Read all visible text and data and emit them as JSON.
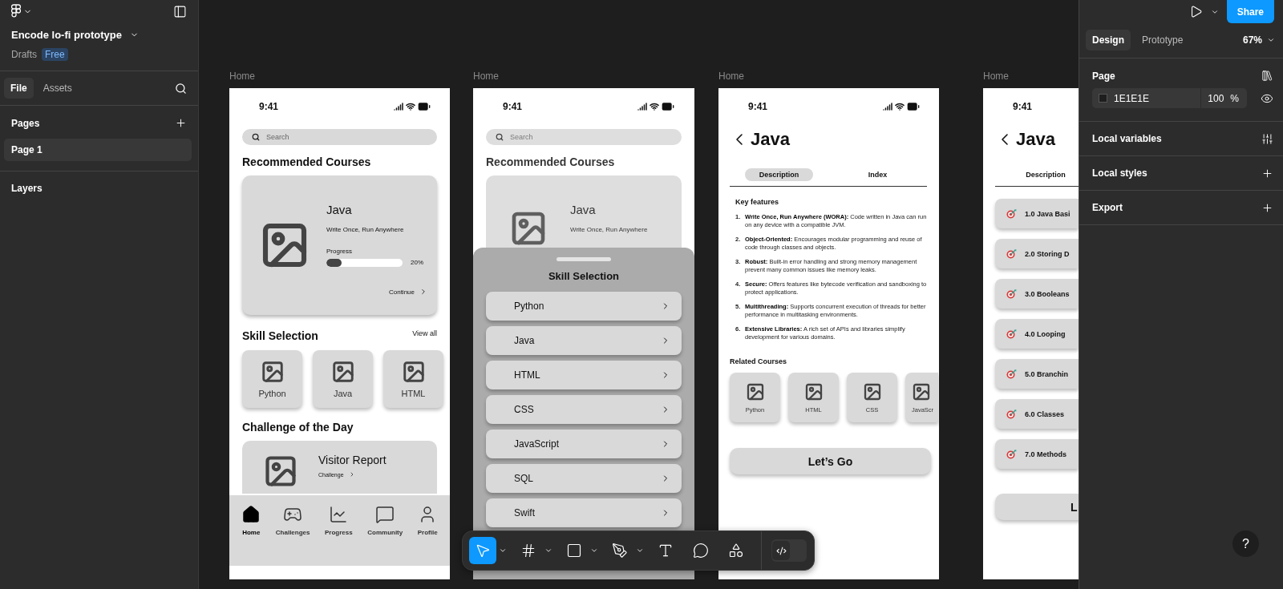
{
  "sidebar": {
    "file_name": "Encode lo-fi prototype",
    "location": "Drafts",
    "plan": "Free",
    "tabs": [
      {
        "label": "File",
        "selected": true
      },
      {
        "label": "Assets",
        "selected": false
      }
    ],
    "pages_title": "Pages",
    "pages": [
      {
        "label": "Page 1",
        "selected": true
      }
    ],
    "layers_title": "Layers"
  },
  "frames": [
    {
      "kind": "home",
      "label": "Home",
      "time": "9:41",
      "search_placeholder": "Search",
      "recommended_title": "Recommended Courses",
      "course": {
        "title": "Java",
        "subtitle": "Write Once, Run Anywhere",
        "progress_label": "Progress",
        "level": 0.2,
        "reading": "20%",
        "action": "Continue"
      },
      "skills_title": "Skill Selection",
      "view_all": "View all",
      "skills": [
        "Python",
        "Java",
        "HTML"
      ],
      "challenge_title": "Challenge of the Day",
      "challenge": {
        "title": "Visitor Report",
        "action": "Challenge"
      },
      "nav": [
        {
          "label": "Home",
          "selected": true
        },
        {
          "label": "Challenges",
          "selected": false
        },
        {
          "label": "Progress",
          "selected": false
        },
        {
          "label": "Community",
          "selected": false
        },
        {
          "label": "Profile",
          "selected": false
        }
      ]
    },
    {
      "kind": "sheet",
      "label": "Home",
      "time": "9:41",
      "search_placeholder": "Search",
      "recommended_title": "Recommended Courses",
      "course": {
        "title": "Java",
        "subtitle": "Write Once, Run Anywhere"
      },
      "sheet": {
        "title": "Skill Selection",
        "items": [
          "Python",
          "Java",
          "HTML",
          "CSS",
          "JavaScript",
          "SQL",
          "Swift"
        ]
      }
    },
    {
      "kind": "detail",
      "label": "Home",
      "time": "9:41",
      "title": "Java",
      "tabs": [
        {
          "label": "Description",
          "selected": true
        },
        {
          "label": "Index",
          "selected": false
        }
      ],
      "features_title": "Key features",
      "features": [
        {
          "number": "1.",
          "text": "**Write Once, Run Anywhere (WORA):** Code written in Java can run on any device with a compatible JVM."
        },
        {
          "number": "2.",
          "text": "**Object-Oriented:** Encourages modular programming and reuse of code through classes and objects."
        },
        {
          "number": "3.",
          "text": "**Robust:** Built-in error handling and strong memory management prevent many common issues like memory leaks."
        },
        {
          "number": "4.",
          "text": "**Secure:** Offers features like bytecode verification and sandboxing to protect applications."
        },
        {
          "number": "5.",
          "text": "**Multithreading:** Supports concurrent execution of threads for better performance in multitasking environments."
        },
        {
          "number": "6.",
          "text": "**Extensive Libraries:** A rich set of APIs and libraries simplify development for various domains."
        }
      ],
      "related_title": "Related Courses",
      "related": [
        "Python",
        "HTML",
        "CSS",
        "JavaScr"
      ],
      "cta": "Let’s Go"
    },
    {
      "kind": "index",
      "label": "Home",
      "time": "9:41",
      "title": "Java",
      "tabs": [
        {
          "label": "Description",
          "selected": false
        }
      ],
      "lessons": [
        "1.0 Java Basi",
        "2.0 Storing D",
        "3.0 Booleans",
        "4.0 Looping",
        "5.0 Branchin",
        "6.0 Classes",
        "7.0 Methods"
      ],
      "cta": "L"
    }
  ],
  "toolbar": {
    "tools": [
      {
        "kind": "move",
        "selected": true,
        "menu": true
      },
      {
        "kind": "frame",
        "selected": false,
        "menu": true
      },
      {
        "kind": "shape",
        "selected": false,
        "menu": true
      },
      {
        "kind": "pen",
        "selected": false,
        "menu": true
      },
      {
        "kind": "text",
        "selected": false,
        "menu": false
      },
      {
        "kind": "comment",
        "selected": false,
        "menu": false
      },
      {
        "kind": "actions",
        "selected": false,
        "menu": false
      }
    ],
    "dev_mode": {
      "on": false
    }
  },
  "properties": {
    "share": "Share",
    "tabs": [
      {
        "label": "Design",
        "selected": true
      },
      {
        "label": "Prototype",
        "selected": false
      }
    ],
    "zoom": "67%",
    "page_title": "Page",
    "fill": {
      "hex": "1E1E1E",
      "opacity": "100",
      "unit": "%"
    },
    "sections": [
      {
        "kind": "variables",
        "label": "Local variables"
      },
      {
        "kind": "add",
        "label": "Local styles"
      },
      {
        "kind": "add",
        "label": "Export"
      }
    ],
    "help": "?"
  }
}
